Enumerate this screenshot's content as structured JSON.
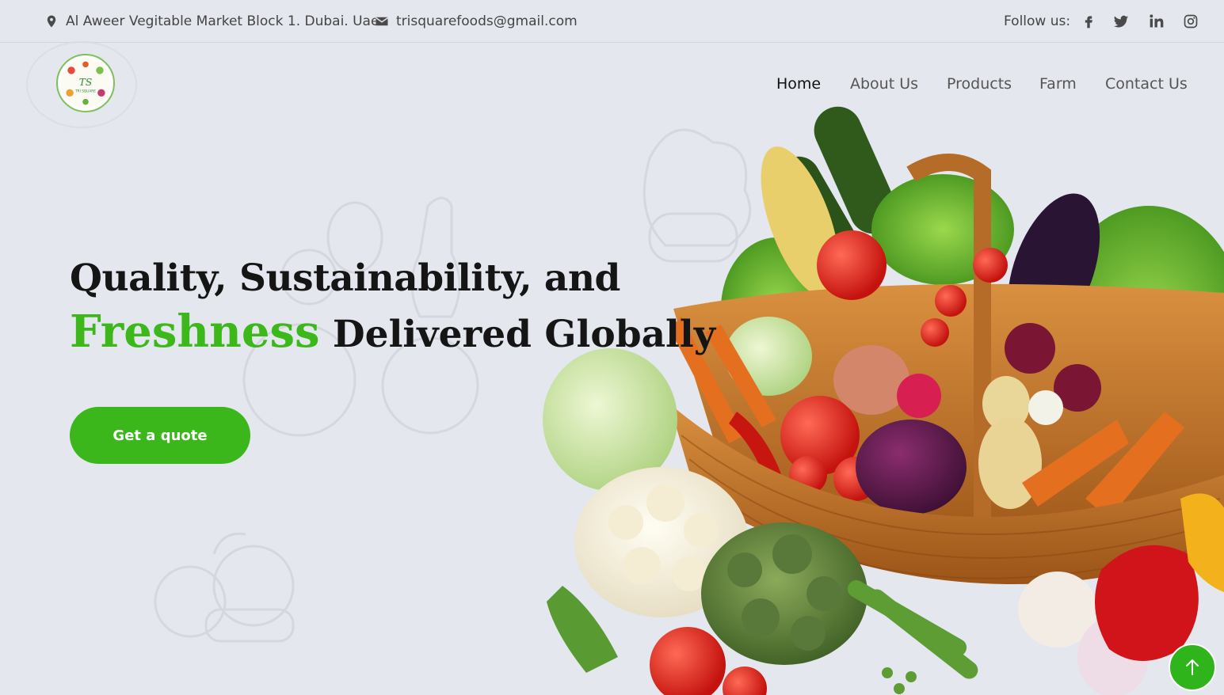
{
  "topbar": {
    "address": "Al Aweer Vegitable Market Block 1. Dubai. Uae",
    "email": "trisquarefoods@gmail.com",
    "follow_label": "Follow us:",
    "social": [
      "facebook-icon",
      "twitter-icon",
      "linkedin-icon",
      "instagram-icon"
    ]
  },
  "logo": {
    "text": "TS",
    "subtext": "TRI SQUARE"
  },
  "nav": {
    "items": [
      "Home",
      "About Us",
      "Products",
      "Farm",
      "Contact Us"
    ],
    "active": "Home"
  },
  "hero": {
    "line1": "Quality, Sustainability, and",
    "highlight": "Freshness",
    "line2_rest": " Delivered Globally",
    "cta_label": "Get a quote"
  },
  "colors": {
    "background": "#e4e7ed",
    "accent_green": "#3cb81a",
    "button_green": "#3bb61b",
    "text_dark": "#151515"
  }
}
